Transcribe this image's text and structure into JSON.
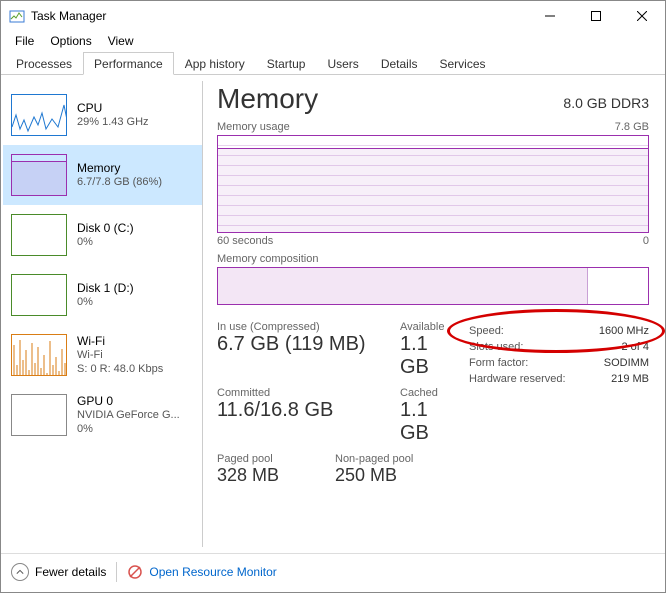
{
  "window": {
    "title": "Task Manager"
  },
  "menu": {
    "file": "File",
    "options": "Options",
    "view": "View"
  },
  "tabs": {
    "processes": "Processes",
    "performance": "Performance",
    "app_history": "App history",
    "startup": "Startup",
    "users": "Users",
    "details": "Details",
    "services": "Services"
  },
  "sidebar": [
    {
      "title": "CPU",
      "sub": "29% 1.43 GHz",
      "kind": "cpu"
    },
    {
      "title": "Memory",
      "sub": "6.7/7.8 GB (86%)",
      "kind": "mem",
      "selected": true
    },
    {
      "title": "Disk 0 (C:)",
      "sub": "0%",
      "kind": "disk0"
    },
    {
      "title": "Disk 1 (D:)",
      "sub": "0%",
      "kind": "disk1"
    },
    {
      "title": "Wi-Fi",
      "sub": "Wi-Fi",
      "sub2": "S: 0 R: 48.0 Kbps",
      "kind": "wifi"
    },
    {
      "title": "GPU 0",
      "sub": "NVIDIA GeForce G...",
      "sub2": "0%",
      "kind": "gpu"
    }
  ],
  "main": {
    "title": "Memory",
    "capacity": "8.0 GB DDR3",
    "usage_label": "Memory usage",
    "usage_max": "7.8 GB",
    "xaxis_left": "60 seconds",
    "xaxis_right": "0",
    "comp_label": "Memory composition",
    "stats": {
      "in_use_lbl": "In use (Compressed)",
      "in_use_val": "6.7 GB (119 MB)",
      "avail_lbl": "Available",
      "avail_val": "1.1 GB",
      "committed_lbl": "Committed",
      "committed_val": "11.6/16.8 GB",
      "cached_lbl": "Cached",
      "cached_val": "1.1 GB",
      "paged_lbl": "Paged pool",
      "paged_val": "328 MB",
      "nonpaged_lbl": "Non-paged pool",
      "nonpaged_val": "250 MB"
    },
    "specs": {
      "speed_k": "Speed:",
      "speed_v": "1600 MHz",
      "slots_k": "Slots used:",
      "slots_v": "2 of 4",
      "form_k": "Form factor:",
      "form_v": "SODIMM",
      "hw_k": "Hardware reserved:",
      "hw_v": "219 MB"
    }
  },
  "footer": {
    "fewer": "Fewer details",
    "orm": "Open Resource Monitor"
  },
  "colors": {
    "memory_accent": "#9b2fae",
    "cpu_accent": "#1f78d1",
    "disk_accent": "#4a8b2a",
    "wifi_accent": "#d97d15",
    "annotation": "#d40000"
  },
  "chart_data": {
    "type": "area",
    "title": "Memory usage",
    "ylabel": "GB",
    "ylim": [
      0,
      7.8
    ],
    "xlabel": "seconds",
    "xlim": [
      60,
      0
    ],
    "series": [
      {
        "name": "In use",
        "approx_value": 6.7,
        "unit": "GB",
        "note": "roughly flat across 60s window"
      }
    ],
    "composition": {
      "type": "bar",
      "total": 7.8,
      "used_fraction_approx": 0.86
    }
  }
}
